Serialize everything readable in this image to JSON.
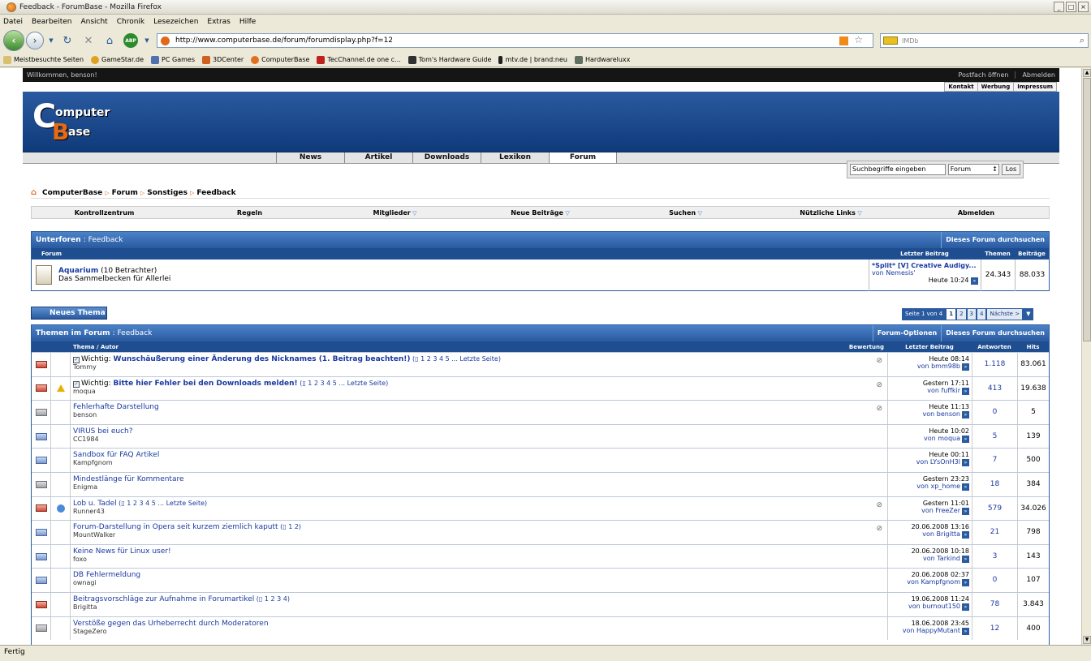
{
  "browser": {
    "title": "Feedback - ForumBase - Mozilla Firefox",
    "menu": [
      "Datei",
      "Bearbeiten",
      "Ansicht",
      "Chronik",
      "Lesezeichen",
      "Extras",
      "Hilfe"
    ],
    "url": "http://www.computerbase.de/forum/forumdisplay.php?f=12",
    "search_placeholder": "IMDb",
    "bookmarks": [
      "Meistbesuchte Seiten",
      "GameStar.de",
      "PC Games",
      "3DCenter",
      "ComputerBase",
      "TecChannel.de one c...",
      "Tom's Hardware Guide",
      "mtv.de | brand:neu",
      "Hardwareluxx"
    ],
    "status": "Fertig"
  },
  "site": {
    "welcome": "Willkommen, benson!",
    "top_right": [
      "Postfach öffnen",
      "Abmelden"
    ],
    "top_links": [
      "Kontakt",
      "Werbung",
      "Impressum"
    ],
    "logo_c": "C",
    "logo_omp": "omputer",
    "logo_b": "B",
    "logo_ase": "ase",
    "tabs": [
      "News",
      "Artikel",
      "Downloads",
      "Lexikon",
      "Forum"
    ],
    "search_placeholder": "Suchbegriffe eingeben",
    "search_scope": "Forum",
    "search_go": "Los"
  },
  "breadcrumb": [
    "ComputerBase",
    "Forum",
    "Sonstiges",
    "Feedback"
  ],
  "subnav": [
    "Kontrollzentrum",
    "Regeln",
    "Mitglieder",
    "Neue Beiträge",
    "Suchen",
    "Nützliche Links",
    "Abmelden"
  ],
  "subforums": {
    "title": "Unterforen",
    "title_sub": ": Feedback",
    "search": "Dieses Forum durchsuchen",
    "col_forum": "Forum",
    "col_last": "Letzter Beitrag",
    "col_topics": "Themen",
    "col_posts": "Beiträge",
    "row": {
      "name": "Aquarium",
      "viewers": "(10 Betrachter)",
      "desc": "Das Sammelbecken für Allerlei",
      "last_title": "*Split* [V] Creative Audigy...",
      "last_by": "von Nemesis'",
      "last_time": "Heute 10:24",
      "topics": "24.343",
      "posts": "88.033"
    }
  },
  "new_topic": "Neues Thema",
  "pager": [
    "Seite 1 von 4",
    "1",
    "2",
    "3",
    "4",
    "Nächste >"
  ],
  "threads": {
    "title": "Themen im Forum",
    "title_sub": ": Feedback",
    "opt1": "Forum-Optionen",
    "opt2": "Dieses Forum durchsuchen",
    "col_topic": "Thema / Autor",
    "col_rating": "Bewertung",
    "col_last": "Letzter Beitrag",
    "col_replies": "Antworten",
    "col_hits": "Hits",
    "rows": [
      {
        "prefix": "Wichtig:",
        "title": "Wunschäußerung einer Änderung des Nicknames (1. Beitrag beachten!)",
        "pages": "1 2 3 4 5 ... Letzte Seite",
        "author": "Tommy",
        "last_time": "Heute 08:14",
        "last_by": "von bmm98b",
        "replies": "1.118",
        "hits": "83.061"
      },
      {
        "prefix": "Wichtig:",
        "title": "Bitte hier Fehler bei den Downloads melden!",
        "pages": "1 2 3 4 5 ... Letzte Seite",
        "author": "moqua",
        "last_time": "Gestern 17:11",
        "last_by": "von fuffkir",
        "replies": "413",
        "hits": "19.638"
      },
      {
        "prefix": "",
        "title": "Fehlerhafte Darstellung",
        "pages": "",
        "author": "benson",
        "last_time": "Heute 11:13",
        "last_by": "von benson",
        "replies": "0",
        "hits": "5"
      },
      {
        "prefix": "",
        "title": "VIRUS bei euch?",
        "pages": "",
        "author": "CC1984",
        "last_time": "Heute 10:02",
        "last_by": "von moqua",
        "replies": "5",
        "hits": "139"
      },
      {
        "prefix": "",
        "title": "Sandbox für FAQ Artikel",
        "pages": "",
        "author": "Kampfgnom",
        "last_time": "Heute 00:11",
        "last_by": "von LYsOnH3l",
        "replies": "7",
        "hits": "500"
      },
      {
        "prefix": "",
        "title": "Mindestlänge für Kommentare",
        "pages": "",
        "author": "Enigma",
        "last_time": "Gestern 23:23",
        "last_by": "von xp_home",
        "replies": "18",
        "hits": "384"
      },
      {
        "prefix": "",
        "title": "Lob u. Tadel",
        "pages": "1 2 3 4 5 ... Letzte Seite",
        "author": "Runner43",
        "last_time": "Gestern 11:01",
        "last_by": "von FreeZer",
        "replies": "579",
        "hits": "34.026"
      },
      {
        "prefix": "",
        "title": "Forum-Darstellung in Opera seit kurzem ziemlich kaputt",
        "pages": "1 2",
        "author": "MountWalker",
        "last_time": "20.06.2008 13:16",
        "last_by": "von Brigitta",
        "replies": "21",
        "hits": "798"
      },
      {
        "prefix": "",
        "title": "Keine News für Linux user!",
        "pages": "",
        "author": "foxo",
        "last_time": "20.06.2008 10:18",
        "last_by": "von Tarkind",
        "replies": "3",
        "hits": "143"
      },
      {
        "prefix": "",
        "title": "DB Fehlermeldung",
        "pages": "",
        "author": "ownagi",
        "last_time": "20.06.2008 02:37",
        "last_by": "von Kampfgnom",
        "replies": "0",
        "hits": "107"
      },
      {
        "prefix": "",
        "title": "Beitragsvorschläge zur Aufnahme in Forumartikel",
        "pages": "1 2 3 4",
        "author": "Brigitta",
        "last_time": "19.06.2008 11:24",
        "last_by": "von burnout150",
        "replies": "78",
        "hits": "3.843"
      },
      {
        "prefix": "",
        "title": "Verstöße gegen das Urheberrecht durch Moderatoren",
        "pages": "",
        "author": "StageZero",
        "last_time": "18.06.2008 23:45",
        "last_by": "von HappyMutant",
        "replies": "12",
        "hits": "400"
      }
    ]
  }
}
